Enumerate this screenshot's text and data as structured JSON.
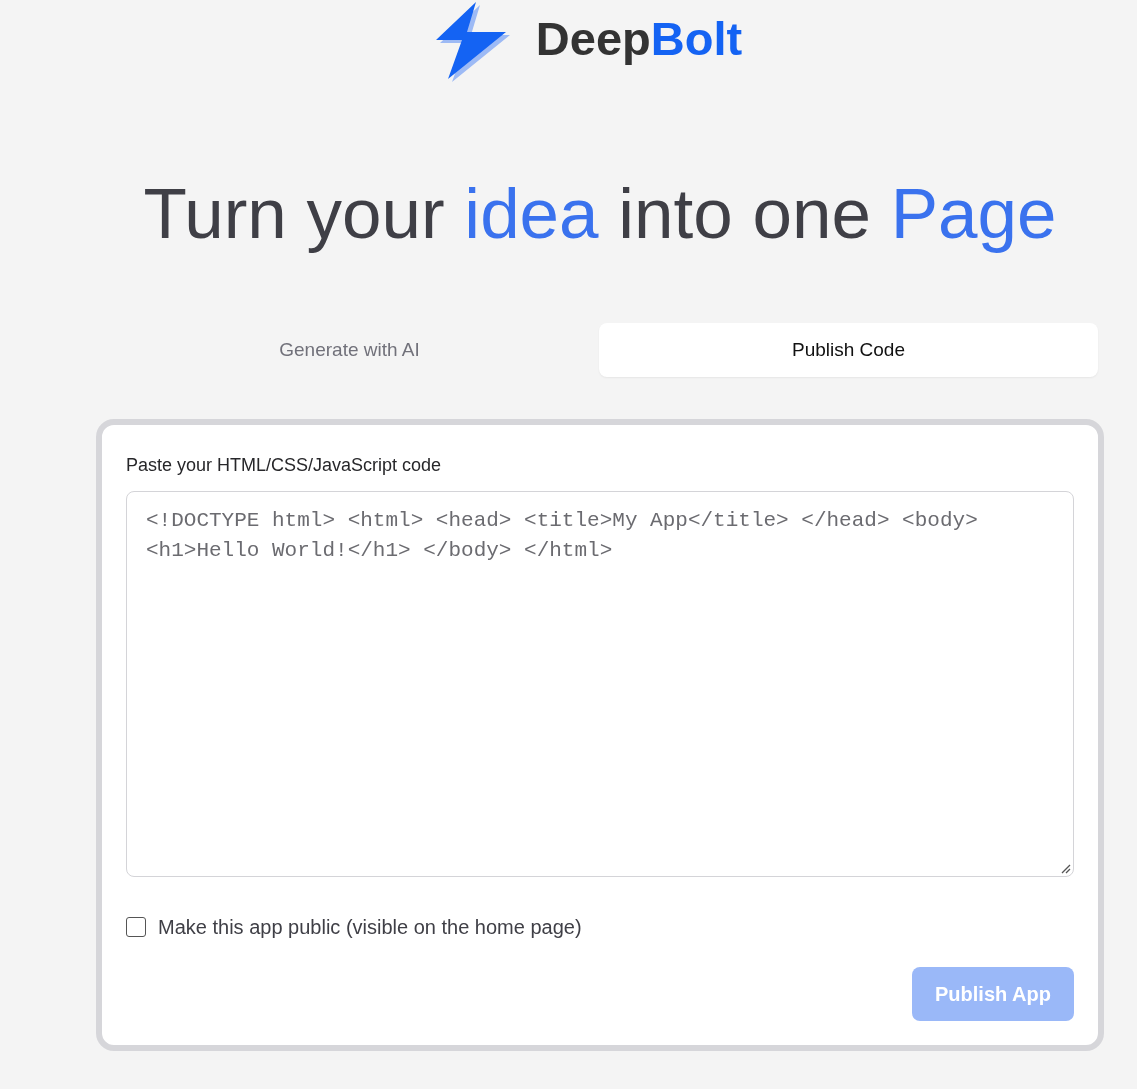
{
  "logo": {
    "parts": [
      {
        "text": "Deep",
        "accent": false
      },
      {
        "text": "Bolt",
        "accent": true
      }
    ]
  },
  "headline": [
    {
      "text": "Turn your",
      "accent": false
    },
    {
      "text": "idea",
      "accent": true
    },
    {
      "text": "into one",
      "accent": false
    },
    {
      "text": "Page",
      "accent": true
    }
  ],
  "tabs": [
    {
      "label": "Generate with AI",
      "selected": false
    },
    {
      "label": "Publish Code",
      "selected": true
    }
  ],
  "code_form": {
    "label": "Paste your HTML/CSS/JavaScript code",
    "code_field": {
      "placeholder": "<!DOCTYPE html> <html> <head> <title>My App</title> </head> <body> <h1>Hello World!</h1> </body> </html>"
    },
    "public_option": {
      "label": "Make this app public (visible on the home page)",
      "checked": false
    },
    "submit_button": {
      "label": "Publish App",
      "disabled": true
    }
  }
}
